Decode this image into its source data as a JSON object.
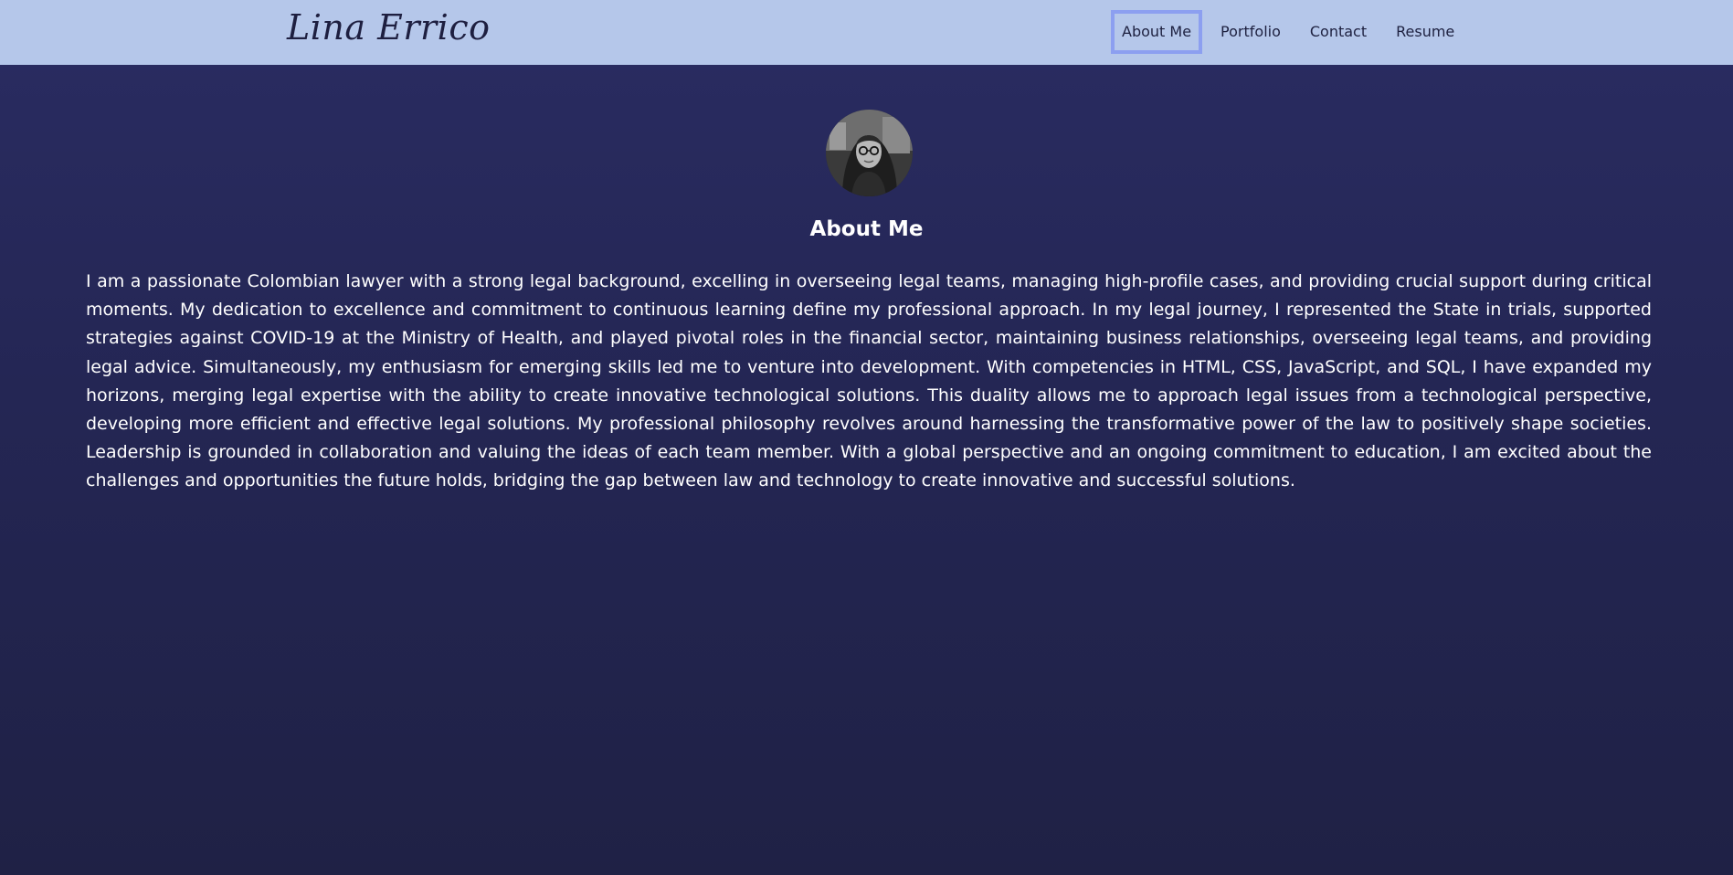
{
  "header": {
    "brand": "Lina Errico",
    "nav": [
      {
        "label": "About Me",
        "active": true
      },
      {
        "label": "Portfolio",
        "active": false
      },
      {
        "label": "Contact",
        "active": false
      },
      {
        "label": "Resume",
        "active": false
      }
    ]
  },
  "about": {
    "title": "About Me",
    "text": "I am a passionate Colombian lawyer with a strong legal background, excelling in overseeing legal teams, managing high-profile cases, and providing crucial support during critical moments. My dedication to excellence and commitment to continuous learning define my professional approach. In my legal journey, I represented the State in trials, supported strategies against COVID-19 at the Ministry of Health, and played pivotal roles in the financial sector, maintaining business relationships, overseeing legal teams, and providing legal advice. Simultaneously, my enthusiasm for emerging skills led me to venture into development. With competencies in HTML, CSS, JavaScript, and SQL, I have expanded my horizons, merging legal expertise with the ability to create innovative technological solutions. This duality allows me to approach legal issues from a technological perspective, developing more efficient and effective legal solutions. My professional philosophy revolves around harnessing the transformative power of the law to positively shape societies. Leadership is grounded in collaboration and valuing the ideas of each team member. With a global perspective and an ongoing commitment to education, I am excited about the challenges and opportunities the future holds, bridging the gap between law and technology to create innovative and successful solutions."
  },
  "colors": {
    "header_bg": "#b5c7ea",
    "active_border": "#8c9ff0",
    "page_bg_top": "#2a2c62",
    "page_bg_bottom": "#1f2145",
    "text": "#ffffff"
  }
}
